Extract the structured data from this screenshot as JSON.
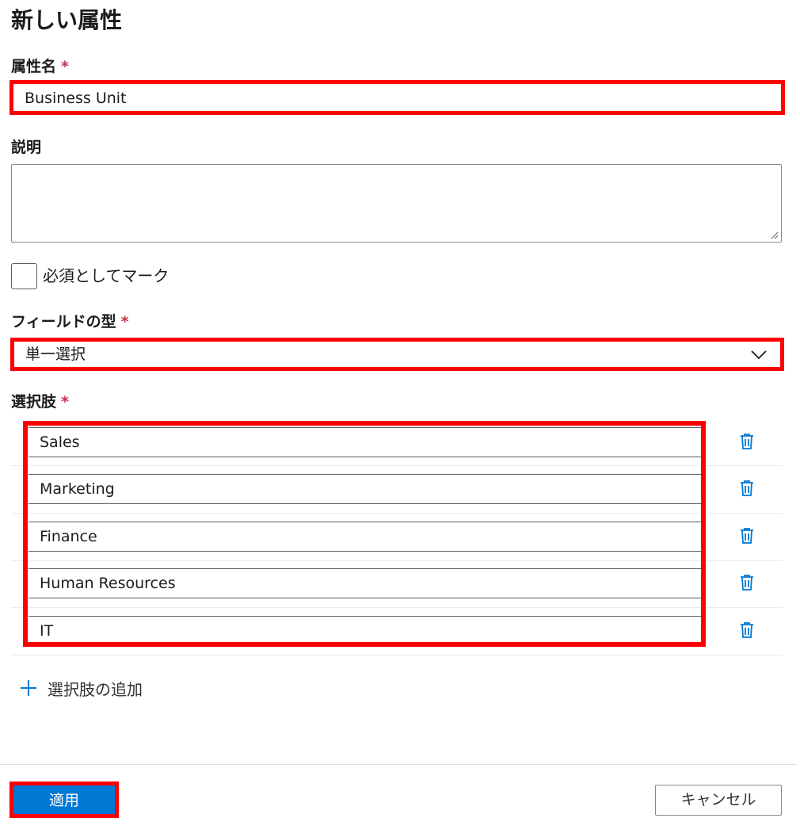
{
  "panel": {
    "title": "新しい属性"
  },
  "attribute_name": {
    "label": "属性名",
    "required_mark": "*",
    "value": "Business Unit"
  },
  "description": {
    "label": "説明",
    "value": ""
  },
  "mark_required": {
    "label": "必須としてマーク",
    "checked": false
  },
  "field_type": {
    "label": "フィールドの型",
    "required_mark": "*",
    "selected": "単一選択"
  },
  "choices": {
    "label": "選択肢",
    "required_mark": "*",
    "items": [
      {
        "value": "Sales"
      },
      {
        "value": "Marketing"
      },
      {
        "value": "Finance"
      },
      {
        "value": "Human Resources"
      },
      {
        "value": "IT"
      }
    ],
    "add_label": "選択肢の追加"
  },
  "footer": {
    "apply_label": "適用",
    "cancel_label": "キャンセル"
  },
  "colors": {
    "accent": "#0078d4",
    "required": "#c4314b",
    "highlight": "#ff0000"
  },
  "icons": {
    "delete": "trash-icon",
    "add": "plus-icon",
    "dropdown": "chevron-down-icon"
  }
}
